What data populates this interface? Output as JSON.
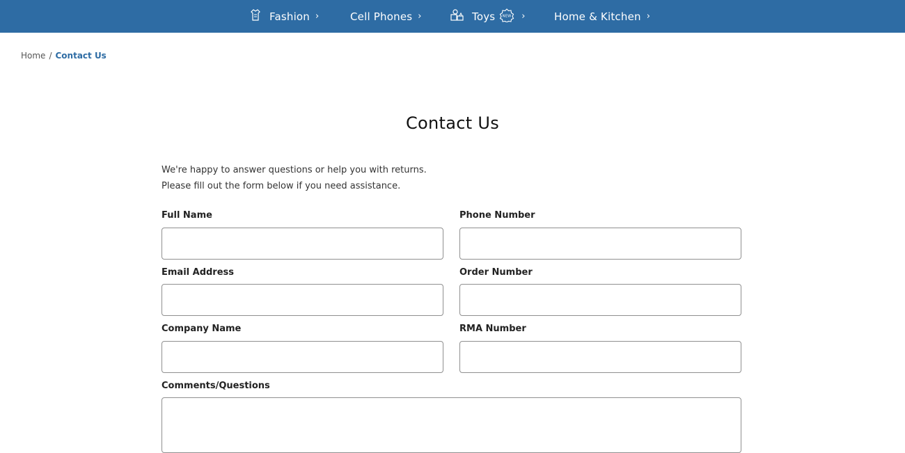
{
  "nav": {
    "items": [
      {
        "label": "Fashion",
        "icon": "fashion-icon"
      },
      {
        "label": "Cell Phones",
        "icon": ""
      },
      {
        "label": "Toys",
        "icon": "toys-icon",
        "badge": "NEW"
      },
      {
        "label": "Home & Kitchen",
        "icon": ""
      }
    ],
    "chevron": "›",
    "background_color": "#2e6ca4"
  },
  "breadcrumb": {
    "home": "Home",
    "separator": "/",
    "current": "Contact Us"
  },
  "page": {
    "title": "Contact Us",
    "intro_line1": "We're happy to answer questions or help you with returns.",
    "intro_line2": "Please fill out the form below if you need assistance."
  },
  "form": {
    "full_name": {
      "label": "Full Name",
      "value": ""
    },
    "phone_number": {
      "label": "Phone Number",
      "value": ""
    },
    "email_address": {
      "label": "Email Address",
      "value": ""
    },
    "order_number": {
      "label": "Order Number",
      "value": ""
    },
    "company_name": {
      "label": "Company Name",
      "value": ""
    },
    "rma_number": {
      "label": "RMA Number",
      "value": ""
    },
    "comments": {
      "label": "Comments/Questions",
      "value": ""
    }
  }
}
